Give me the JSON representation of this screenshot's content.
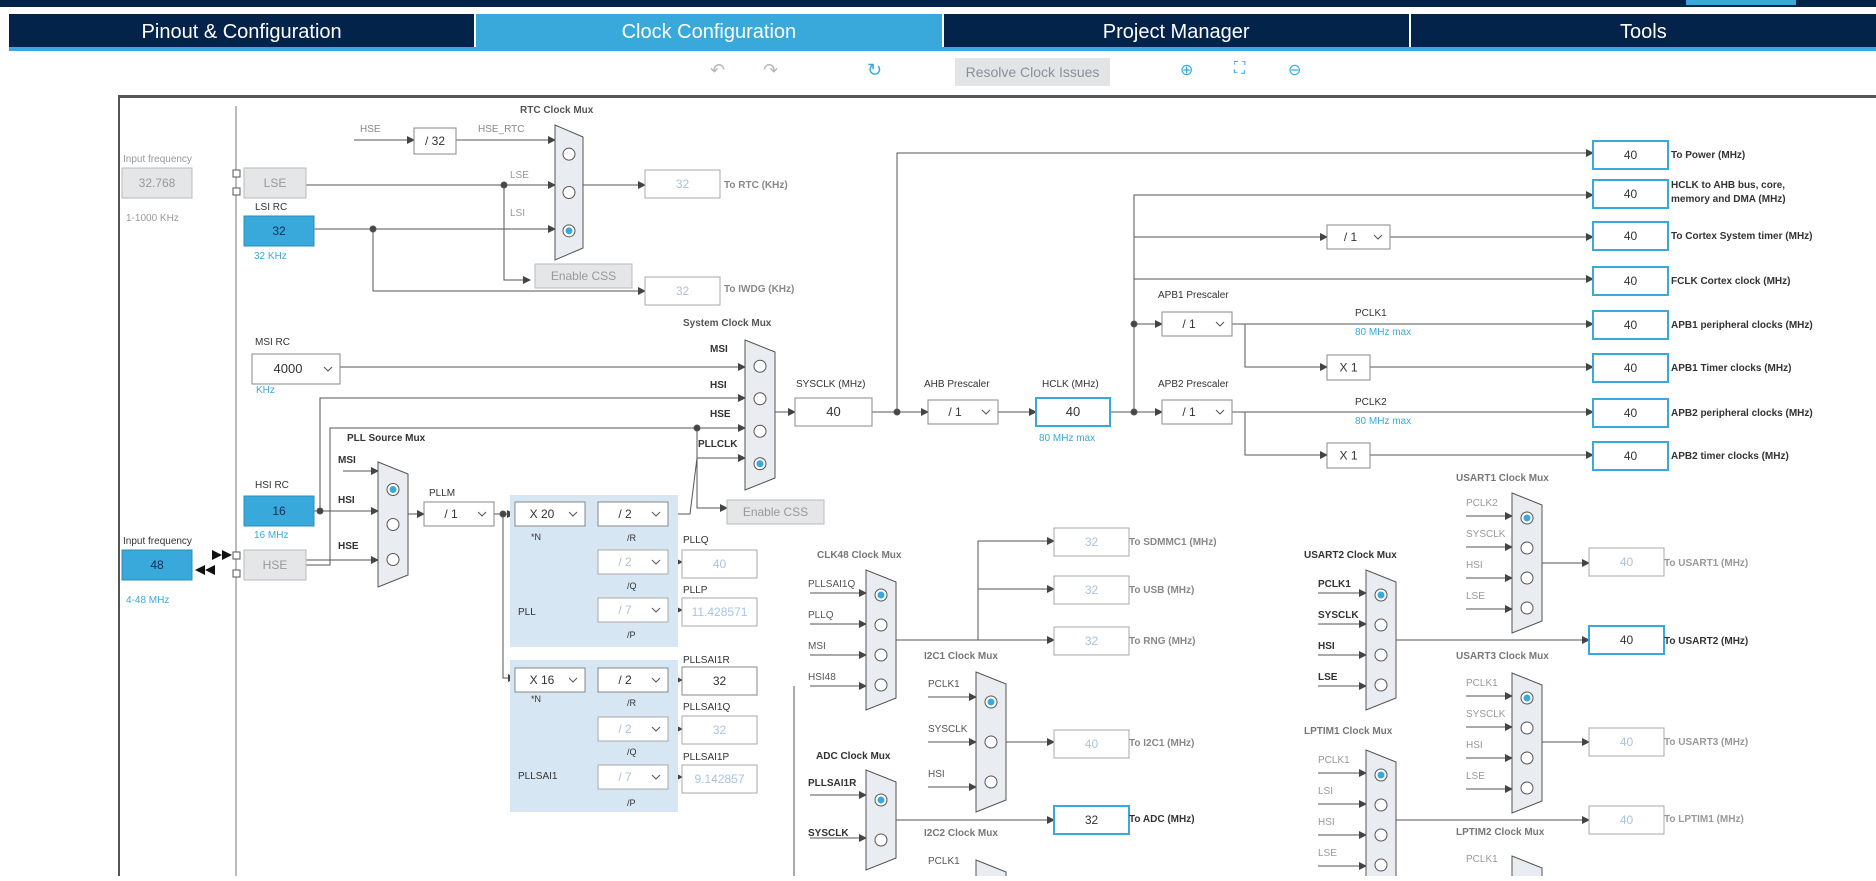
{
  "tabs": [
    "Pinout & Configuration",
    "Clock Configuration",
    "Project Manager",
    "Tools"
  ],
  "toolbar": {
    "resolve_label": "Resolve Clock Issues"
  },
  "input_freq": {
    "label": "Input frequency",
    "lse_value": "32.768",
    "lse_range": "1-1000 KHz",
    "hse_value": "48",
    "hse_range": "4-48 MHz"
  },
  "osc": {
    "lse": "LSE",
    "lsi": "LSI RC",
    "lsi_value": "32",
    "lsi_unit": "32 KHz",
    "msi": "MSI RC",
    "msi_value": "4000",
    "msi_unit": "KHz",
    "hsi": "HSI RC",
    "hsi_value": "16",
    "hsi_unit": "16 MHz",
    "hse": "HSE"
  },
  "rtc": {
    "title": "RTC Clock Mux",
    "hse": "HSE",
    "div": "/ 32",
    "hse_rtc": "HSE_RTC",
    "lse": "LSE",
    "lsi": "LSI",
    "rtc_value": "32",
    "rtc_label": "To RTC (KHz)",
    "iwdg_value": "32",
    "iwdg_label": "To IWDG (KHz)",
    "css": "Enable CSS"
  },
  "sysmux": {
    "title": "System Clock Mux",
    "msi": "MSI",
    "hsi": "HSI",
    "hse": "HSE",
    "pllclk": "PLLCLK",
    "css": "Enable CSS"
  },
  "pllsrc": {
    "title": "PLL Source Mux",
    "msi": "MSI",
    "hsi": "HSI",
    "hse": "HSE"
  },
  "pll": {
    "pllm_label": "PLLM",
    "pllm": "/ 1",
    "n": "X 20",
    "n_lbl": "*N",
    "r": "/ 2",
    "r_lbl": "/R",
    "q": "/ 2",
    "q_lbl": "/Q",
    "p": "/ 7",
    "p_lbl": "/P",
    "name": "PLL",
    "pllq_lbl": "PLLQ",
    "pllq": "40",
    "pllp_lbl": "PLLP",
    "pllp": "11.428571"
  },
  "pllsai1": {
    "n": "X 16",
    "n_lbl": "*N",
    "r": "/ 2",
    "r_lbl": "/R",
    "q": "/ 2",
    "q_lbl": "/Q",
    "p": "/ 7",
    "p_lbl": "/P",
    "name": "PLLSAI1",
    "r_out_lbl": "PLLSAI1R",
    "r_out": "32",
    "q_out_lbl": "PLLSAI1Q",
    "q_out": "32",
    "p_out_lbl": "PLLSAI1P",
    "p_out": "9.142857"
  },
  "sysclk": {
    "label": "SYSCLK (MHz)",
    "value": "40",
    "ahb_label": "AHB Prescaler",
    "ahb": "/ 1",
    "hclk_label": "HCLK (MHz)",
    "hclk": "40",
    "hclk_max": "80 MHz max"
  },
  "apb": {
    "apb1_label": "APB1 Prescaler",
    "apb1": "/ 1",
    "apb2_label": "APB2 Prescaler",
    "apb2": "/ 1",
    "pclk1": "PCLK1",
    "pclk1_max": "80 MHz max",
    "pclk2": "PCLK2",
    "pclk2_max": "80 MHz max",
    "x1a": "X 1",
    "x1b": "X 1",
    "cortex_div": "/ 1"
  },
  "outputs": [
    {
      "value": "40",
      "label": "To Power (MHz)"
    },
    {
      "value": "40",
      "label": "HCLK to AHB bus, core,",
      "label2": "memory and DMA (MHz)"
    },
    {
      "value": "40",
      "label": "To Cortex System timer (MHz)"
    },
    {
      "value": "40",
      "label": "FCLK Cortex clock (MHz)"
    },
    {
      "value": "40",
      "label": "APB1 peripheral clocks (MHz)"
    },
    {
      "value": "40",
      "label": "APB1 Timer clocks (MHz)"
    },
    {
      "value": "40",
      "label": "APB2 peripheral clocks (MHz)"
    },
    {
      "value": "40",
      "label": "APB2 timer clocks (MHz)"
    }
  ],
  "clk48": {
    "title": "CLK48 Clock Mux",
    "in": [
      "PLLSAI1Q",
      "PLLQ",
      "MSI",
      "HSI48"
    ],
    "sdmmc": "32",
    "sdmmc_lbl": "To SDMMC1 (MHz)",
    "usb": "32",
    "usb_lbl": "To USB (MHz)",
    "rng": "32",
    "rng_lbl": "To RNG (MHz)"
  },
  "i2c1": {
    "title": "I2C1 Clock Mux",
    "in": [
      "PCLK1",
      "SYSCLK",
      "HSI"
    ],
    "value": "40",
    "out_lbl": "To I2C1 (MHz)"
  },
  "adc": {
    "title": "ADC Clock Mux",
    "in": [
      "PLLSAI1R",
      "SYSCLK"
    ],
    "value": "32",
    "out_lbl": "To ADC (MHz)"
  },
  "i2c2": {
    "title": "I2C2 Clock Mux",
    "in": [
      "PCLK1"
    ]
  },
  "usart1": {
    "title": "USART1 Clock Mux",
    "in": [
      "PCLK2",
      "SYSCLK",
      "HSI",
      "LSE"
    ],
    "value": "40",
    "out_lbl": "To USART1 (MHz)"
  },
  "usart2": {
    "title": "USART2 Clock Mux",
    "in": [
      "PCLK1",
      "SYSCLK",
      "HSI",
      "LSE"
    ],
    "value": "40",
    "out_lbl": "To USART2 (MHz)"
  },
  "usart3": {
    "title": "USART3 Clock Mux",
    "in": [
      "PCLK1",
      "SYSCLK",
      "HSI",
      "LSE"
    ],
    "value": "40",
    "out_lbl": "To USART3 (MHz)"
  },
  "lptim1": {
    "title": "LPTIM1 Clock Mux",
    "in": [
      "PCLK1",
      "LSI",
      "HSI",
      "LSE"
    ],
    "value": "40",
    "out_lbl": "To LPTIM1 (MHz)"
  },
  "lptim2": {
    "title": "LPTIM2 Clock Mux",
    "in": [
      "PCLK1"
    ]
  },
  "colors": {
    "navy": "#03234b",
    "accent": "#39a9dc",
    "lines": "#555555"
  }
}
